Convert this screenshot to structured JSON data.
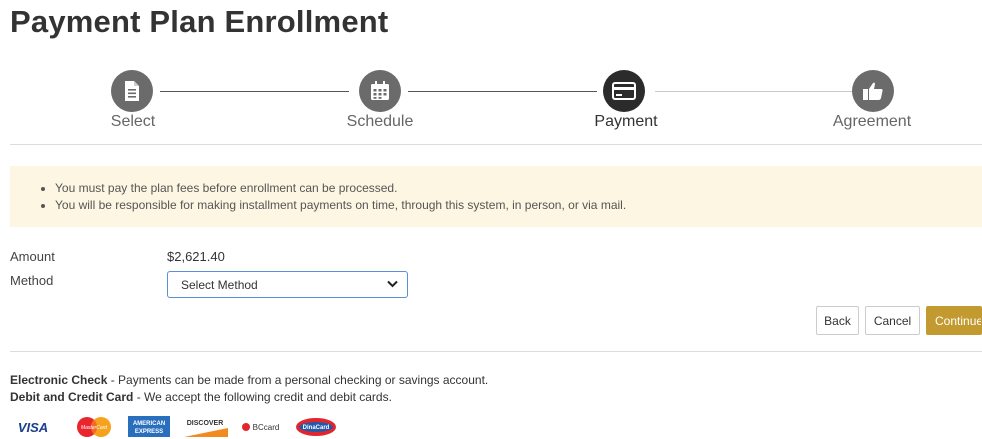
{
  "page": {
    "title": "Payment Plan Enrollment"
  },
  "stepper": {
    "steps": [
      {
        "label": "Select",
        "icon": "document-icon",
        "state": "complete"
      },
      {
        "label": "Schedule",
        "icon": "calendar-icon",
        "state": "complete"
      },
      {
        "label": "Payment",
        "icon": "credit-card-icon",
        "state": "active"
      },
      {
        "label": "Agreement",
        "icon": "thumbs-up-icon",
        "state": "pending"
      }
    ]
  },
  "notice": {
    "items": [
      "You must pay the plan fees before enrollment can be processed.",
      "You will be responsible for making installment payments on time, through this system, in person, or via mail."
    ]
  },
  "form": {
    "amount_label": "Amount",
    "amount_value": "$2,621.40",
    "method_label": "Method",
    "method_selected": "Select Method"
  },
  "actions": {
    "back_label": "Back",
    "cancel_label": "Cancel",
    "continue_label": "Continue"
  },
  "payment_info": {
    "echeck_title": "Electronic Check",
    "echeck_text": " - Payments can be made from a personal checking or savings account.",
    "card_title": "Debit and Credit Card",
    "card_text": " - We accept the following credit and debit cards."
  },
  "cards": {
    "visa": "VISA",
    "mastercard": "MasterCard",
    "amex_line1": "AMERICAN",
    "amex_line2": "EXPRESS",
    "discover": "DISCOVER",
    "bccard": "BCcard",
    "dinacard": "DinaCard"
  },
  "colors": {
    "accent": "#c39a30",
    "notice_bg": "#fcf6e2",
    "step_active": "#2b2b2b",
    "step_done": "#6b6b6b"
  }
}
